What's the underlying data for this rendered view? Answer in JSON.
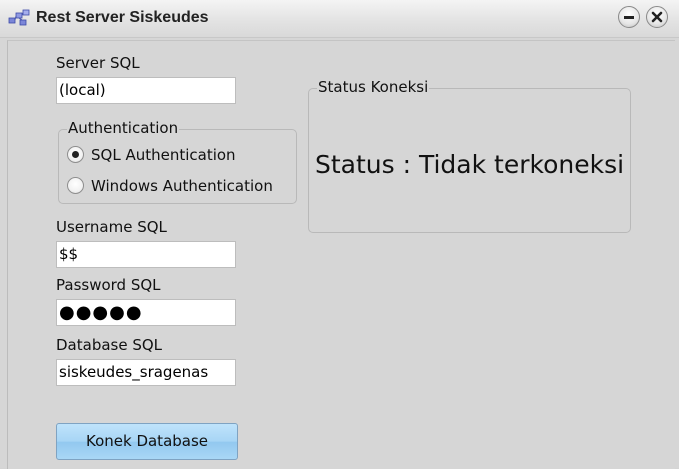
{
  "window": {
    "title": "Rest Server Siskeudes",
    "icon": "network-servers-icon"
  },
  "controls": {
    "minimize_icon": "minimize-icon",
    "close_icon": "close-icon"
  },
  "form": {
    "server_label": "Server SQL",
    "server_value": "(local)",
    "auth_group_label": "Authentication",
    "auth_options": [
      {
        "label": "SQL Authentication",
        "selected": true
      },
      {
        "label": "Windows Authentication",
        "selected": false
      }
    ],
    "username_label": "Username SQL",
    "username_value": "$$",
    "password_label": "Password SQL",
    "password_value": "●●●●●",
    "database_label": "Database SQL",
    "database_value": "siskeudes_sragenas",
    "connect_button": "Konek Database"
  },
  "status": {
    "group_label": "Status Koneksi",
    "text": "Status : Tidak terkoneksi"
  }
}
